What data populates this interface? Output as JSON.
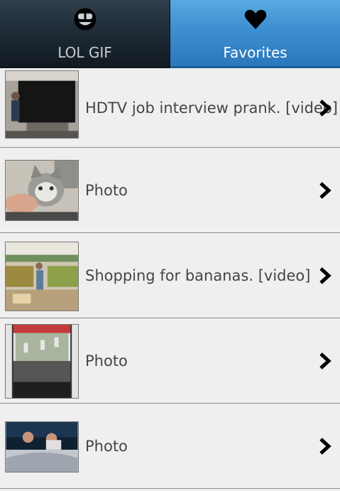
{
  "tabs": [
    {
      "label": "LOL GIF",
      "icon": "smiley-icon",
      "active": false
    },
    {
      "label": "Favorites",
      "icon": "heart-icon",
      "active": true
    }
  ],
  "items": [
    {
      "title": "HDTV job interview prank. [video]",
      "thumb": "office-tv-thumbnail"
    },
    {
      "title": "Photo",
      "thumb": "kitten-thumbnail"
    },
    {
      "title": "Shopping for bananas. [video]",
      "thumb": "grocery-store-thumbnail"
    },
    {
      "title": "Photo",
      "thumb": "race-track-thumbnail"
    },
    {
      "title": "Photo",
      "thumb": "couple-in-bed-thumbnail"
    }
  ],
  "colors": {
    "active_tab": "#3d8ed0",
    "inactive_tab": "#1c2833",
    "list_bg": "#efefef",
    "text": "#454545"
  }
}
